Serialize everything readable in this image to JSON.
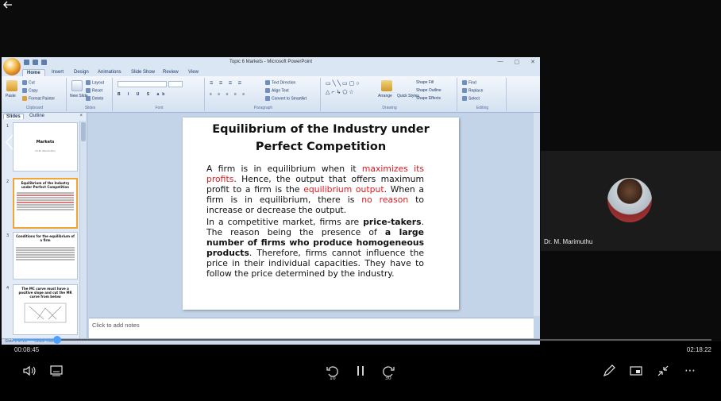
{
  "player": {
    "back_icon": "arrow-left-icon",
    "current_time": "00:08:45",
    "total_time": "02:18:22",
    "progress": 0.0632,
    "skip_back_seconds": "10",
    "skip_forward_seconds": "30",
    "accent_color": "#4ea0ff"
  },
  "presenter": {
    "name": "Dr. M. Marimuthu"
  },
  "powerpoint": {
    "window_title": "Topic 6 Markets - Microsoft PowerPoint",
    "tabs": [
      "Home",
      "Insert",
      "Design",
      "Animations",
      "Slide Show",
      "Review",
      "View"
    ],
    "ribbon": {
      "clipboard": {
        "cut": "Cut",
        "copy": "Copy",
        "paste": "Paste",
        "format_painter": "Format Painter",
        "group": "Clipboard"
      },
      "slides": {
        "layout": "Layout",
        "reset": "Reset",
        "new_slide": "New Slide",
        "delete": "Delete",
        "group": "Slides"
      },
      "font": {
        "group": "Font"
      },
      "paragraph": {
        "text_direction": "Text Direction",
        "align_text": "Align Text",
        "convert_smartart": "Convert to SmartArt",
        "group": "Paragraph"
      },
      "drawing": {
        "arrange": "Arrange",
        "quick_styles": "Quick Styles",
        "shape_fill": "Shape Fill",
        "shape_outline": "Shape Outline",
        "shape_effects": "Shape Effects",
        "group": "Drawing"
      },
      "editing": {
        "find": "Find",
        "replace": "Replace",
        "select": "Select",
        "group": "Editing"
      }
    },
    "side_tabs": {
      "slides": "Slides",
      "outline": "Outline"
    },
    "thumbnails": [
      {
        "num": "1",
        "title": "Markets",
        "sub": "Dr.M. Marimuthu"
      },
      {
        "num": "2",
        "title": "Equilibrium of the Industry under Perfect Competition"
      },
      {
        "num": "3",
        "title": "Conditions for the equilibrium of a firm"
      },
      {
        "num": "4",
        "title": "The MC curve must have a positive slope and cut the MR curve from below"
      }
    ],
    "notes_placeholder": "Click to add notes",
    "status": "Slide 2 of 29",
    "theme": "Office Theme"
  },
  "slide": {
    "title_line1": "Equilibrium of the Industry under",
    "title_line2": "Perfect Competition",
    "p1": {
      "a": "A firm is in equilibrium when it ",
      "b": "maximizes its profits",
      "c": ". Hence, the output that offers maximum profit to a firm is the ",
      "d": "equilibrium output",
      "e": ". When a firm is in equilibrium, there is ",
      "f": "no reason",
      "g": " to increase or decrease the output."
    },
    "p2": {
      "a": "In a competitive market, firms are ",
      "b": "price-takers",
      "c": ". The reason being the presence of ",
      "d": "a large number of firms who produce homogeneous products",
      "e": ". Therefore, firms cannot influence the price in their individual capacities. They have to follow the price determined by the industry."
    },
    "highlight_color": "#e0191e"
  }
}
